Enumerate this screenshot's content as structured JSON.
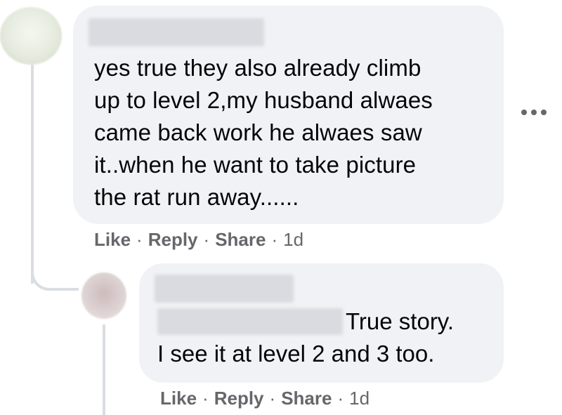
{
  "comment": {
    "text_lines": [
      "yes true they also already climb",
      "up to level 2,my husband alwaes",
      "came back work he alwaes saw",
      "it..when he want to take picture",
      "the rat run away......"
    ],
    "actions": {
      "like": "Like",
      "reply": "Reply",
      "share": "Share",
      "time": "1d"
    },
    "more_icon": "more-horizontal-icon"
  },
  "reply": {
    "text_line1": "True story.",
    "text_line2": "I see it at level 2 and 3 too.",
    "actions": {
      "like": "Like",
      "reply": "Reply",
      "share": "Share",
      "time": "1d"
    }
  },
  "separator": "·",
  "colors": {
    "bubble": "#f0f2f5",
    "meta": "#65676b",
    "text": "#050505",
    "thread": "#dadde1"
  }
}
